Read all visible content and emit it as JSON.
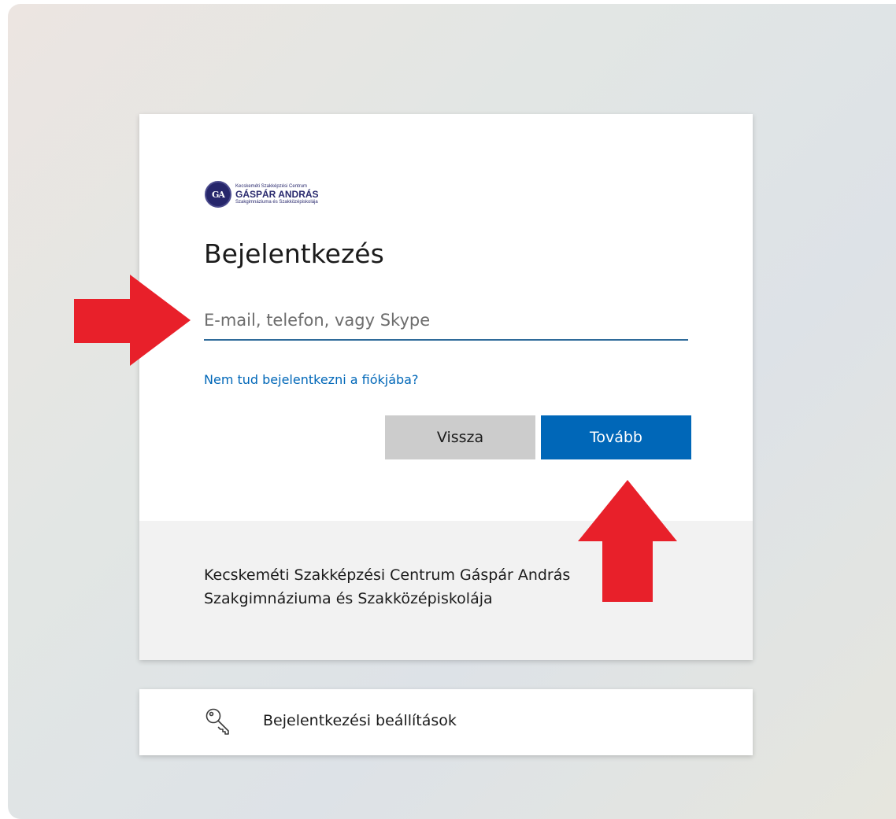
{
  "logo": {
    "line1": "Kecskeméti Szakképzési Centrum",
    "line2": "GÁSPÁR ANDRÁS",
    "line3": "Szakgimnáziuma és Szakközépiskolája"
  },
  "signin": {
    "title": "Bejelentkezés",
    "email_placeholder": "E-mail, telefon, vagy Skype",
    "help_link": "Nem tud bejelentkezni a fiókjába?",
    "back_label": "Vissza",
    "next_label": "Tovább"
  },
  "footer": {
    "line1": "Kecskeméti Szakképzési Centrum Gáspár András",
    "line2": "Szakgimnáziuma és Szakközépiskolája"
  },
  "options": {
    "label": "Bejelentkezési beállítások"
  },
  "colors": {
    "accent": "#0067b8",
    "arrow": "#e8202a"
  }
}
